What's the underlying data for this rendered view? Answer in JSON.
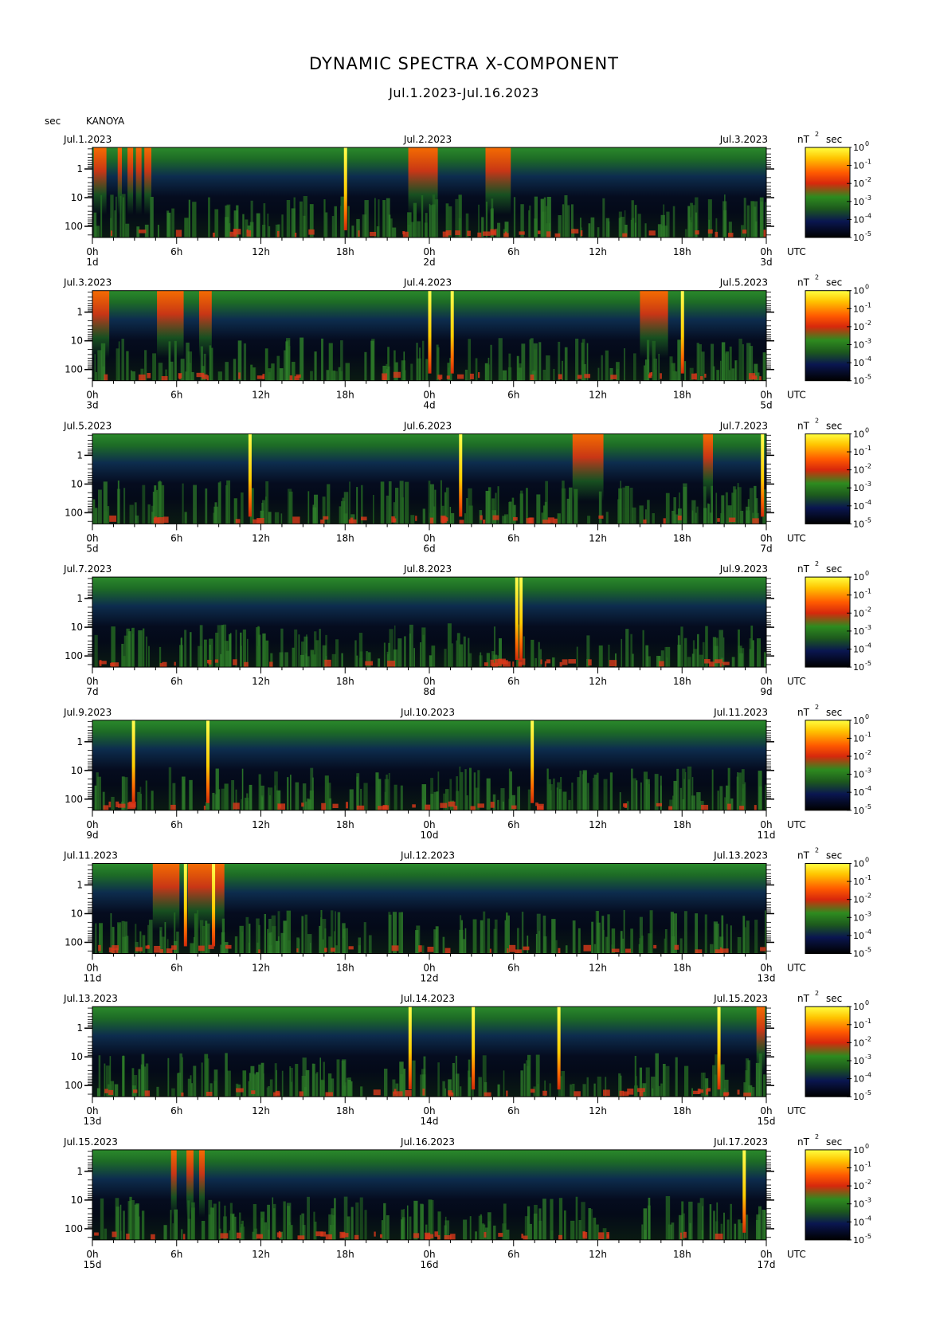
{
  "header": {
    "title": "DYNAMIC SPECTRA X-COMPONENT",
    "subtitle": "Jul.1.2023-Jul.16.2023",
    "period_axis_unit": "sec",
    "station": "KANOYA"
  },
  "chart_data": {
    "type": "heatmap",
    "title": "DYNAMIC SPECTRA X-COMPONENT",
    "subtitle": "Jul.1.2023-Jul.16.2023",
    "station": "KANOYA",
    "ylabel": "sec",
    "y_scale": "log",
    "y_ticks": [
      "1",
      "10",
      "100"
    ],
    "x_ticks": [
      "0h",
      "6h",
      "12h",
      "18h",
      "0h",
      "6h",
      "12h",
      "18h",
      "0h"
    ],
    "x_unit": "UTC",
    "colorbar": {
      "unit": "nT",
      "unit_suffix": "sec",
      "unit_exponent": "2",
      "scale": "log",
      "tick_labels": [
        "10",
        "10",
        "10",
        "10",
        "10",
        "10"
      ],
      "tick_exponents": [
        "0",
        "-1",
        "-2",
        "-3",
        "-4",
        "-5"
      ],
      "colors": [
        "#000000",
        "#0a1650",
        "#1d6a1d",
        "#2e8b1f",
        "#e03a10",
        "#ff5a00",
        "#ffc400",
        "#ffff40"
      ]
    },
    "panels": [
      {
        "left_date": "Jul.1.2023",
        "mid_date": "Jul.2.2023",
        "right_date": "Jul.3.2023",
        "day_labels": [
          "1d",
          "2d",
          "3d"
        ],
        "spikes_hours": [
          18.0
        ],
        "bursts_hours": [
          [
            0.1,
            1.0
          ],
          [
            1.8,
            2.1
          ],
          [
            2.5,
            2.9
          ],
          [
            3.1,
            3.5
          ],
          [
            3.7,
            4.2
          ],
          [
            22.5,
            24.6
          ],
          [
            28.0,
            29.8
          ]
        ]
      },
      {
        "left_date": "Jul.3.2023",
        "mid_date": "Jul.4.2023",
        "right_date": "Jul.5.2023",
        "day_labels": [
          "3d",
          "4d",
          "5d"
        ],
        "spikes_hours": [
          24.0,
          25.6,
          42.0
        ],
        "bursts_hours": [
          [
            0.0,
            1.2
          ],
          [
            4.6,
            6.5
          ],
          [
            7.6,
            8.5
          ],
          [
            39.0,
            41.0
          ]
        ]
      },
      {
        "left_date": "Jul.5.2023",
        "mid_date": "Jul.6.2023",
        "right_date": "Jul.7.2023",
        "day_labels": [
          "5d",
          "6d",
          "7d"
        ],
        "spikes_hours": [
          11.2,
          26.2,
          47.7
        ],
        "bursts_hours": [
          [
            34.2,
            36.4
          ],
          [
            43.5,
            44.2
          ]
        ]
      },
      {
        "left_date": "Jul.7.2023",
        "mid_date": "Jul.8.2023",
        "right_date": "Jul.9.2023",
        "day_labels": [
          "7d",
          "8d",
          "9d"
        ],
        "spikes_hours": [
          30.2,
          30.5
        ],
        "bursts_hours": []
      },
      {
        "left_date": "Jul.9.2023",
        "mid_date": "Jul.10.2023",
        "right_date": "Jul.11.2023",
        "day_labels": [
          "9d",
          "10d",
          "11d"
        ],
        "spikes_hours": [
          2.9,
          8.2,
          31.3
        ],
        "bursts_hours": []
      },
      {
        "left_date": "Jul.11.2023",
        "mid_date": "Jul.12.2023",
        "right_date": "Jul.13.2023",
        "day_labels": [
          "11d",
          "12d",
          "13d"
        ],
        "spikes_hours": [
          6.6,
          8.6
        ],
        "bursts_hours": [
          [
            4.3,
            6.2
          ],
          [
            6.8,
            9.4
          ]
        ]
      },
      {
        "left_date": "Jul.13.2023",
        "mid_date": "Jul.14.2023",
        "right_date": "Jul.15.2023",
        "day_labels": [
          "13d",
          "14d",
          "15d"
        ],
        "spikes_hours": [
          22.6,
          27.1,
          33.2,
          44.6
        ],
        "bursts_hours": [
          [
            47.3,
            47.9
          ]
        ]
      },
      {
        "left_date": "Jul.15.2023",
        "mid_date": "Jul.16.2023",
        "right_date": "Jul.17.2023",
        "day_labels": [
          "15d",
          "16d",
          "17d"
        ],
        "spikes_hours": [
          46.4
        ],
        "bursts_hours": [
          [
            5.6,
            6.0
          ],
          [
            6.7,
            7.2
          ],
          [
            7.6,
            8.0
          ]
        ]
      }
    ]
  }
}
